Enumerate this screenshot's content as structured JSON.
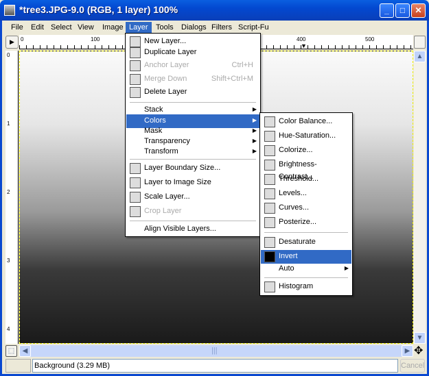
{
  "window": {
    "title": "*tree3.JPG-9.0 (RGB, 1 layer) 100%",
    "minimize": "_",
    "maximize": "□",
    "close": "✕"
  },
  "menubar": [
    {
      "label": "File"
    },
    {
      "label": "Edit"
    },
    {
      "label": "Select"
    },
    {
      "label": "View"
    },
    {
      "label": "Image"
    },
    {
      "label": "Layer",
      "active": true
    },
    {
      "label": "Tools"
    },
    {
      "label": "Dialogs"
    },
    {
      "label": "Filters"
    },
    {
      "label": "Script-Fu"
    }
  ],
  "ruler": {
    "top": [
      "0",
      "100",
      "400",
      "500"
    ],
    "left": [
      "0",
      "1",
      "2",
      "3",
      "4"
    ]
  },
  "layer_menu": [
    {
      "label": "New Layer...",
      "icon": "new-layer-icon"
    },
    {
      "label": "Duplicate Layer",
      "icon": "duplicate-icon"
    },
    {
      "label": "Anchor Layer",
      "shortcut": "Ctrl+H",
      "disabled": true,
      "icon": "anchor-icon"
    },
    {
      "label": "Merge Down",
      "shortcut": "Shift+Ctrl+M",
      "disabled": true,
      "icon": "merge-down-icon"
    },
    {
      "label": "Delete Layer",
      "icon": "trash-icon"
    },
    {
      "label": "Stack",
      "submenu": true
    },
    {
      "label": "Colors",
      "submenu": true,
      "highlighted": true
    },
    {
      "label": "Mask",
      "submenu": true
    },
    {
      "label": "Transparency",
      "submenu": true
    },
    {
      "label": "Transform",
      "submenu": true
    },
    {
      "label": "Layer Boundary Size...",
      "icon": "boundary-size-icon"
    },
    {
      "label": "Layer to Image Size",
      "icon": "layer-to-image-icon"
    },
    {
      "label": "Scale Layer...",
      "icon": "scale-icon"
    },
    {
      "label": "Crop Layer",
      "disabled": true,
      "icon": "crop-icon"
    },
    {
      "label": "Align Visible Layers..."
    }
  ],
  "colors_menu": [
    {
      "label": "Color Balance...",
      "icon": "color-balance-icon"
    },
    {
      "label": "Hue-Saturation...",
      "icon": "hue-saturation-icon"
    },
    {
      "label": "Colorize...",
      "icon": "colorize-icon"
    },
    {
      "label": "Brightness-Contrast...",
      "icon": "brightness-contrast-icon"
    },
    {
      "label": "Threshold...",
      "icon": "threshold-icon"
    },
    {
      "label": "Levels...",
      "icon": "levels-icon"
    },
    {
      "label": "Curves...",
      "icon": "curves-icon"
    },
    {
      "label": "Posterize...",
      "icon": "posterize-icon"
    },
    {
      "label": "Desaturate",
      "icon": "desaturate-icon"
    },
    {
      "label": "Invert",
      "icon": "invert-icon",
      "highlighted": true
    },
    {
      "label": "Auto",
      "submenu": true
    },
    {
      "label": "Histogram",
      "icon": "histogram-icon"
    }
  ],
  "status": {
    "text": "Background (3.29 MB)",
    "cancel": "Cancel"
  },
  "colors": {
    "highlight": "#316ac5",
    "titlebar": "#0348d0"
  }
}
